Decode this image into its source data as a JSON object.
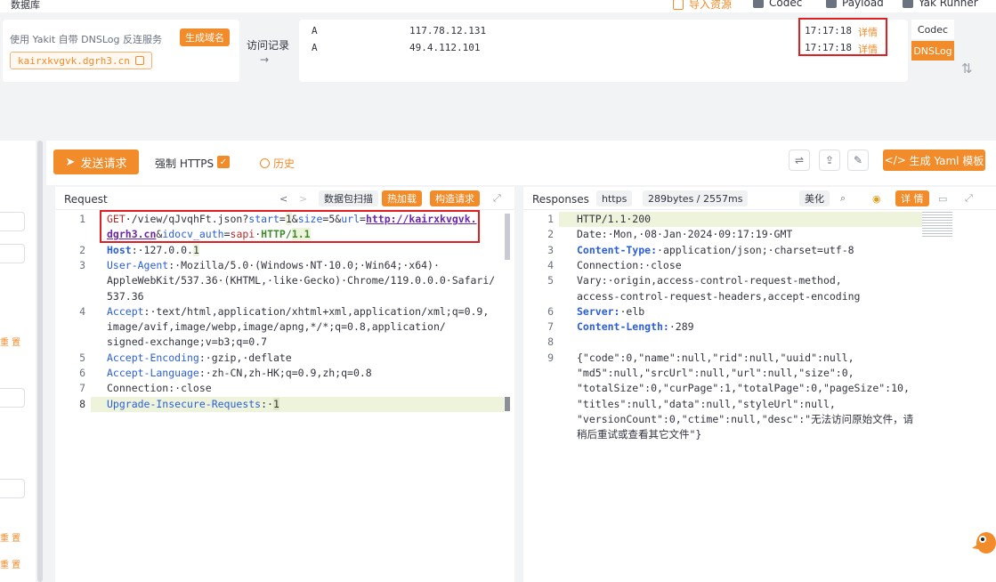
{
  "topbar": {
    "title": "数据库",
    "import_label": "导入资源",
    "codec_label": "Codec",
    "payload_label": "Payload",
    "yakrunner_label": "Yak Runner"
  },
  "dnslog": {
    "label": "使用 Yakit 自带 DNSLog 反连服务",
    "generate_label": "生成域名",
    "domain": "kairxkvgvk.dgrh3.cn",
    "visit_label": "访问记录",
    "arrow": "→",
    "records": [
      {
        "type": "A",
        "ip": "117.78.12.131",
        "time": "17:17:18",
        "detail": "详情"
      },
      {
        "type": "A",
        "ip": "49.4.112.101",
        "time": "17:17:18",
        "detail": "详情"
      }
    ],
    "side_tabs": [
      "Codec",
      "DNSLog"
    ]
  },
  "left": {
    "reset_label": "重 置"
  },
  "toolbar": {
    "send_label": "发送请求",
    "https_label": "强制 HTTPS",
    "history_label": "历史",
    "yaml_label": "生成 Yaml 模板",
    "yaml_prefix": "</>"
  },
  "request": {
    "title": "Request",
    "scan_label": "数据包扫描",
    "hotload_label": "热加载",
    "construct_label": "构造请求",
    "nav_prev": "<",
    "nav_next": ">",
    "lines": [
      {
        "n": "1"
      },
      {
        "n": "2"
      },
      {
        "n": "3"
      },
      {
        "n": "4"
      },
      {
        "n": "5"
      },
      {
        "n": "6"
      },
      {
        "n": "7"
      },
      {
        "n": "8"
      }
    ]
  },
  "response": {
    "title": "Responses",
    "scheme_label": "https",
    "size_label": "289bytes / 2557ms",
    "beautify_label": "美化",
    "detail_label": "详 情",
    "lines": {
      "l1": "HTTP/1.1·200",
      "l2": "Date:·Mon,·08·Jan·2024·09:17:19·GMT",
      "l3k": "Content-Type:",
      "l3v": "·application/json;·charset=utf-8",
      "l4": "Connection:·close",
      "l5a": "Vary:·origin,access-control-request-method,",
      "l5b": "access-control-request-headers,accept-encoding",
      "l6k": "Server:",
      "l6v": "·elb",
      "l7k": "Content-Length:",
      "l7v": "·289",
      "l9a": "{\"code\":0,\"name\":null,\"rid\":null,\"uuid\":null,",
      "l9b": "\"md5\":null,\"srcUrl\":null,\"url\":null,\"size\":0,",
      "l9c": "\"totalSize\":0,\"curPage\":1,\"totalPage\":0,\"pageSize\":10,",
      "l9d": "\"titles\":null,\"data\":null,\"styleUrl\":null,",
      "l9e": "\"versionCount\":0,\"ctime\":null,\"desc\":\"无法访问原始文件，请",
      "l9f": "稍后重试或查看其它文件\"}"
    },
    "numbers": [
      "1",
      "2",
      "3",
      "4",
      "5",
      "6",
      "7",
      "8",
      "9"
    ]
  },
  "req_text": {
    "l1_method": "GET",
    "l1_path": "·/view/qJvqhFt.json?",
    "l1_p1k": "start",
    "l1_p1v": "1",
    "l1_p2k": "size",
    "l1_p2v": "5",
    "l1_p3k": "url",
    "l1_p3v": "http://kairxkvgvk.",
    "l1b_p3v": "dgrh3.cn",
    "l1b_p4k": "idocv_auth",
    "l1b_p4v": "sapi",
    "l1b_proto": "HTTP/",
    "l1b_ver": "1.1",
    "l2k": "Host",
    "l2v": ":·127.0.0.",
    "l2e": "1",
    "l3k": "User-Agent",
    "l3a": ":·Mozilla/5.0·(Windows·NT·10.0;·Win64;·x64)·",
    "l3b": "AppleWebKit/537.36·(KHTML,·like·Gecko)·Chrome/119.0.0.0·Safari/",
    "l3c": "537.36",
    "l4k": "Accept",
    "l4a": ":·text/html,application/xhtml+xml,application/xml;q=0.9,",
    "l4b": "image/avif,image/webp,image/apng,*/*;q=0.8,application/",
    "l4c": "signed-exchange;v=b3;q=0.7",
    "l5k": "Accept-Encoding",
    "l5v": ":·gzip,·deflate",
    "l6k": "Accept-Language",
    "l6v": ":·zh-CN,zh-HK;q=0.9,zh;q=0.8",
    "l7": "Connection:·close",
    "l8k": "Upgrade-Insecure-Requests",
    "l8v": ":·",
    "l8e": "1"
  },
  "colors": {
    "accent": "#f28b2a",
    "highlight_box": "#e02020"
  }
}
